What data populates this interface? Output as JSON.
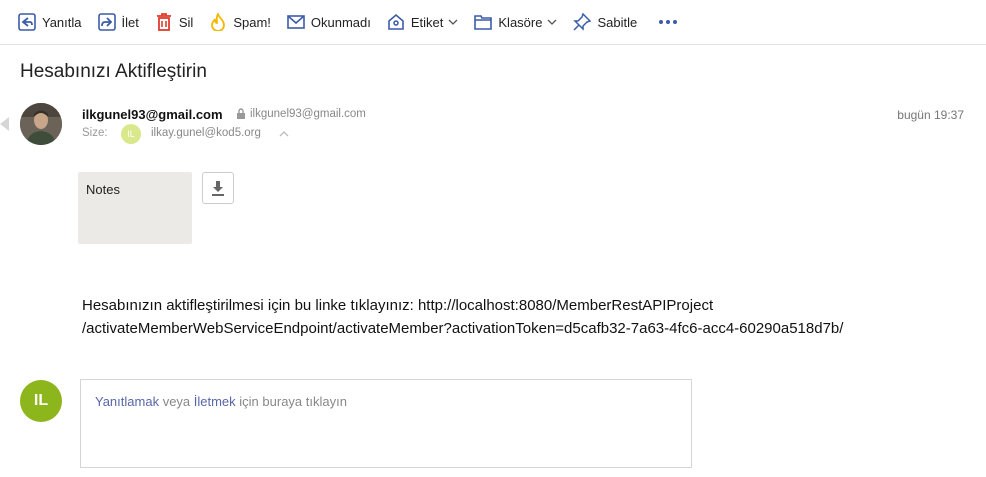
{
  "toolbar": {
    "reply": {
      "label": "Yanıtla",
      "icon": "reply-icon"
    },
    "forward": {
      "label": "İlet",
      "icon": "forward-icon"
    },
    "delete": {
      "label": "Sil",
      "icon": "trash-icon"
    },
    "spam": {
      "label": "Spam!",
      "icon": "flame-icon"
    },
    "unread": {
      "label": "Okunmadı",
      "icon": "envelope-icon"
    },
    "label": {
      "label": "Etiket",
      "icon": "tag-icon"
    },
    "folder": {
      "label": "Klasöre",
      "icon": "folder-icon"
    },
    "pin": {
      "label": "Sabitle",
      "icon": "pin-icon"
    },
    "more": {
      "icon": "more-icon"
    }
  },
  "message": {
    "subject": "Hesabınızı Aktifleştirin",
    "from_name": "ilkgunel93@gmail.com",
    "from_email": "ilkgunel93@gmail.com",
    "to_label": "Size:",
    "to_initials": "IL",
    "to_email": "ilkay.gunel@kod5.org",
    "date": "bugün 19:37",
    "attachment_name": "Notes",
    "body_line1": "Hesabınızın aktifleştirilmesi için bu linke tıklayınız: http://localhost:8080/MemberRestAPIProject",
    "body_line2": "/activateMemberWebServiceEndpoint/activateMember?activationToken=d5cafb32-7a63-4fc6-acc4-60290a518d7b/"
  },
  "reply": {
    "avatar_initials": "IL",
    "reply_link": "Yanıtlamak",
    "or_text": " veya ",
    "forward_link": "İletmek",
    "suffix": " için buraya tıklayın"
  },
  "colors": {
    "accent": "#3b5ca8",
    "delete": "#e33a2f",
    "spam": "#f5b800",
    "reply_avatar": "#8db51c",
    "to_badge": "#d9e88b"
  }
}
